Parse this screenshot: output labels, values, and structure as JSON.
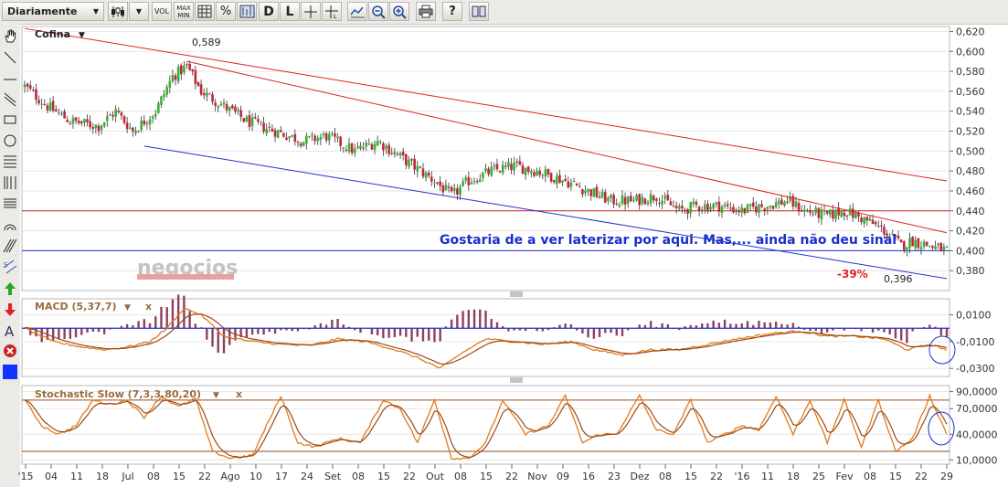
{
  "toolbar": {
    "period": "Diariamente",
    "vol": "VOL",
    "maxmin_top": "MAX",
    "maxmin_bottom": "MIN",
    "pct": "%",
    "d": "D",
    "l": "L"
  },
  "chart_data": [
    {
      "type": "candlestick",
      "title": "Cofina",
      "y_ticks": [
        "0,620",
        "0,600",
        "0,580",
        "0,560",
        "0,540",
        "0,520",
        "0,500",
        "0,480",
        "0,460",
        "0,440",
        "0,420",
        "0,400",
        "0,380"
      ],
      "ylim": [
        0.36,
        0.625
      ],
      "x_ticks": [
        "'15",
        "04",
        "11",
        "18",
        "Jul",
        "08",
        "15",
        "22",
        "Ago",
        "10",
        "17",
        "24",
        "Set",
        "08",
        "15",
        "22",
        "Out",
        "08",
        "15",
        "22",
        "Nov",
        "09",
        "16",
        "23",
        "Dez",
        "08",
        "15",
        "22",
        "'16",
        "11",
        "18",
        "25",
        "Fev",
        "08",
        "15",
        "22",
        "29"
      ],
      "close_anchors": [
        [
          0,
          0.565
        ],
        [
          8,
          0.545
        ],
        [
          16,
          0.53
        ],
        [
          26,
          0.525
        ],
        [
          32,
          0.54
        ],
        [
          38,
          0.52
        ],
        [
          46,
          0.54
        ],
        [
          52,
          0.575
        ],
        [
          57,
          0.585
        ],
        [
          62,
          0.56
        ],
        [
          70,
          0.545
        ],
        [
          78,
          0.53
        ],
        [
          88,
          0.52
        ],
        [
          98,
          0.51
        ],
        [
          106,
          0.515
        ],
        [
          116,
          0.5
        ],
        [
          124,
          0.51
        ],
        [
          134,
          0.49
        ],
        [
          144,
          0.47
        ],
        [
          150,
          0.455
        ],
        [
          156,
          0.47
        ],
        [
          164,
          0.48
        ],
        [
          172,
          0.485
        ],
        [
          180,
          0.48
        ],
        [
          190,
          0.47
        ],
        [
          198,
          0.46
        ],
        [
          206,
          0.45
        ],
        [
          214,
          0.45
        ],
        [
          222,
          0.455
        ],
        [
          230,
          0.44
        ],
        [
          236,
          0.445
        ],
        [
          244,
          0.445
        ],
        [
          252,
          0.44
        ],
        [
          260,
          0.445
        ],
        [
          268,
          0.45
        ],
        [
          274,
          0.44
        ],
        [
          282,
          0.435
        ],
        [
          288,
          0.44
        ],
        [
          296,
          0.43
        ],
        [
          302,
          0.42
        ],
        [
          304,
          0.415
        ],
        [
          308,
          0.405
        ],
        [
          312,
          0.41
        ],
        [
          318,
          0.405
        ],
        [
          324,
          0.4
        ]
      ],
      "annotations": [
        {
          "text": "0,589",
          "value": 0.589
        },
        {
          "text": "0,396",
          "value": 0.396
        },
        {
          "text": "-39%"
        },
        {
          "text": "Gostaria de a ver laterizar por aqui. Mas,... ainda não deu sinal"
        }
      ],
      "trendlines": [
        {
          "color": "#dd2222",
          "from": [
            0,
            0.623
          ],
          "to": [
            324,
            0.47
          ]
        },
        {
          "color": "#dd2222",
          "from": [
            57,
            0.59
          ],
          "to": [
            324,
            0.418
          ]
        },
        {
          "color": "#2233cc",
          "from": [
            42,
            0.505
          ],
          "to": [
            324,
            0.372
          ]
        }
      ],
      "hlines": [
        {
          "color": "#cc2222",
          "value": 0.44
        },
        {
          "color": "#2233cc",
          "value": 0.4
        }
      ],
      "watermark": "negocios"
    },
    {
      "type": "line",
      "title": "MACD (5,37,7)",
      "y_ticks": [
        "0,0100",
        "-0,0100",
        "-0,0300"
      ],
      "ylim": [
        -0.036,
        0.022
      ],
      "zero_value": 0.0,
      "macd_anchors": [
        [
          0,
          0.0
        ],
        [
          10,
          -0.01
        ],
        [
          20,
          -0.014
        ],
        [
          28,
          -0.016
        ],
        [
          36,
          -0.014
        ],
        [
          44,
          -0.01
        ],
        [
          50,
          0.0
        ],
        [
          56,
          0.015
        ],
        [
          62,
          0.01
        ],
        [
          70,
          -0.006
        ],
        [
          80,
          -0.01
        ],
        [
          90,
          -0.012
        ],
        [
          100,
          -0.013
        ],
        [
          110,
          -0.008
        ],
        [
          120,
          -0.01
        ],
        [
          130,
          -0.016
        ],
        [
          138,
          -0.022
        ],
        [
          146,
          -0.03
        ],
        [
          154,
          -0.018
        ],
        [
          162,
          -0.008
        ],
        [
          172,
          -0.01
        ],
        [
          182,
          -0.012
        ],
        [
          192,
          -0.01
        ],
        [
          200,
          -0.016
        ],
        [
          210,
          -0.02
        ],
        [
          220,
          -0.016
        ],
        [
          230,
          -0.016
        ],
        [
          240,
          -0.012
        ],
        [
          250,
          -0.008
        ],
        [
          262,
          -0.004
        ],
        [
          272,
          -0.002
        ],
        [
          282,
          -0.006
        ],
        [
          292,
          -0.006
        ],
        [
          302,
          -0.008
        ],
        [
          310,
          -0.016
        ],
        [
          318,
          -0.012
        ],
        [
          324,
          -0.016
        ]
      ]
    },
    {
      "type": "line",
      "title": "Stochastic Slow (7,3,3,80,20)",
      "y_ticks": [
        "90,0000",
        "70,0000",
        "40,0000",
        "10,0000"
      ],
      "ylim": [
        5,
        97
      ],
      "levels": [
        80,
        20
      ],
      "k_anchors": [
        [
          0,
          80
        ],
        [
          6,
          50
        ],
        [
          12,
          40
        ],
        [
          18,
          50
        ],
        [
          24,
          80
        ],
        [
          30,
          75
        ],
        [
          36,
          80
        ],
        [
          42,
          60
        ],
        [
          48,
          85
        ],
        [
          54,
          72
        ],
        [
          60,
          82
        ],
        [
          66,
          20
        ],
        [
          72,
          12
        ],
        [
          80,
          15
        ],
        [
          90,
          85
        ],
        [
          96,
          30
        ],
        [
          102,
          25
        ],
        [
          110,
          35
        ],
        [
          118,
          30
        ],
        [
          126,
          80
        ],
        [
          132,
          70
        ],
        [
          138,
          30
        ],
        [
          144,
          80
        ],
        [
          150,
          12
        ],
        [
          156,
          12
        ],
        [
          162,
          30
        ],
        [
          168,
          80
        ],
        [
          176,
          40
        ],
        [
          184,
          50
        ],
        [
          190,
          85
        ],
        [
          196,
          30
        ],
        [
          202,
          40
        ],
        [
          208,
          40
        ],
        [
          216,
          85
        ],
        [
          222,
          45
        ],
        [
          228,
          40
        ],
        [
          234,
          80
        ],
        [
          240,
          30
        ],
        [
          246,
          40
        ],
        [
          252,
          50
        ],
        [
          258,
          45
        ],
        [
          264,
          85
        ],
        [
          270,
          40
        ],
        [
          276,
          80
        ],
        [
          282,
          30
        ],
        [
          288,
          80
        ],
        [
          294,
          25
        ],
        [
          300,
          80
        ],
        [
          306,
          20
        ],
        [
          312,
          35
        ],
        [
          318,
          85
        ],
        [
          324,
          40
        ]
      ]
    }
  ]
}
